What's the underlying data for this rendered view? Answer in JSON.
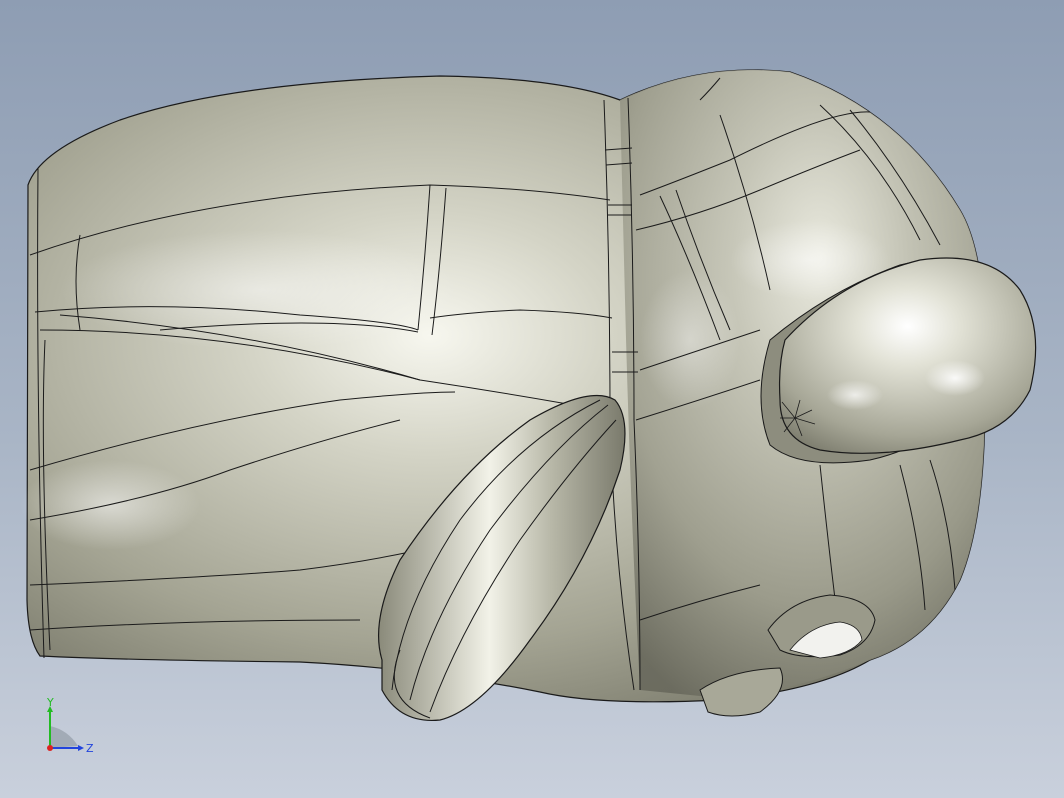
{
  "viewport": {
    "background_top": "#8e9db3",
    "background_bottom": "#c9d0dc",
    "model_color": "#b6b6a6",
    "edge_color": "#1a1a1a"
  },
  "triad": {
    "y_label": "Y",
    "z_label": "Z",
    "y_color": "#22bb22",
    "z_color": "#2244dd",
    "x_color": "#dd2222"
  }
}
